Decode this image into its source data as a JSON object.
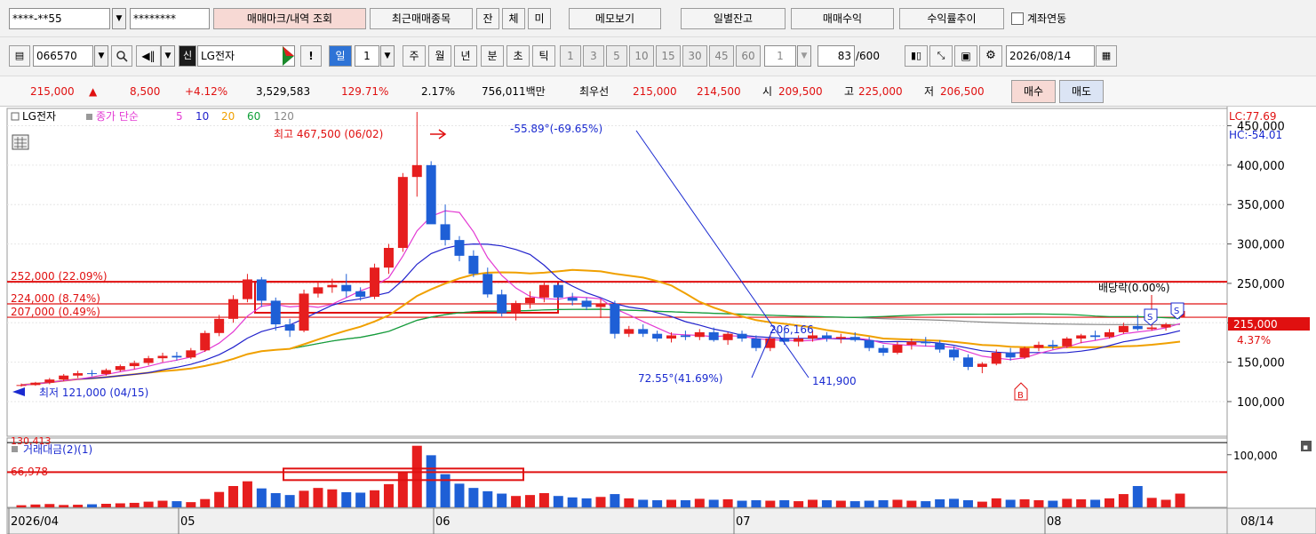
{
  "toolbar1": {
    "account": "****-**55",
    "password": "********",
    "btn_trade_mark": "매매마크/내역 조회",
    "btn_recent": "최근매매종목",
    "btn_jan": "잔",
    "btn_che": "체",
    "btn_mi": "미",
    "btn_memo": "메모보기",
    "btn_daily": "일별잔고",
    "btn_profit": "매매수익",
    "btn_rate": "수익률추이",
    "link_label": "계좌연동"
  },
  "toolbar2": {
    "code": "066570",
    "badge": "신",
    "name": "LG전자",
    "excl": "!",
    "period_active": "일",
    "period_num": "1",
    "periods": [
      "주",
      "월",
      "년",
      "분",
      "초",
      "틱"
    ],
    "intervals": [
      "1",
      "3",
      "5",
      "10",
      "15",
      "30",
      "45",
      "60"
    ],
    "interval_value": "1",
    "count": "83",
    "count_max": "/600",
    "date": "2026/08/14"
  },
  "quote": {
    "price": "215,000",
    "arrow": "▲",
    "change": "8,500",
    "change_pct": "+4.12%",
    "volume": "3,529,583",
    "vol_ratio": "129.71%",
    "turnover": "2.17%",
    "amount": "756,011백만",
    "best_label": "최우선",
    "ask": "215,000",
    "bid": "214,500",
    "open_label": "시",
    "open": "209,500",
    "high_label": "고",
    "high": "225,000",
    "low_label": "저",
    "low": "206,500",
    "buy": "매수",
    "sell": "매도"
  },
  "chart_data": {
    "type": "candlestick",
    "legend": {
      "name": "LG전자",
      "series_label": "종가 단순",
      "ma": [
        {
          "period": "5",
          "color": "#e33ad3"
        },
        {
          "period": "10",
          "color": "#2222cc"
        },
        {
          "period": "20",
          "color": "#f0a000"
        },
        {
          "period": "60",
          "color": "#0fa038"
        },
        {
          "period": "120",
          "color": "#888888"
        }
      ]
    },
    "lc": "LC:77.69",
    "hc": "HC:-54.01",
    "y_ticks": [
      "450,000",
      "400,000",
      "350,000",
      "300,000",
      "250,000",
      "200,000",
      "150,000",
      "100,000"
    ],
    "y_tick_values": [
      450000,
      400000,
      350000,
      300000,
      250000,
      200000,
      150000,
      100000
    ],
    "ylim": [
      56000,
      472000
    ],
    "current_price_label": "215,000",
    "current_pct_label": "4.37%",
    "h_levels": [
      {
        "value": 252000,
        "label": "252,000 (22.09%)"
      },
      {
        "value": 224000,
        "label": "224,000 (8.74%)"
      },
      {
        "value": 207000,
        "label": "207,000 (0.49%)"
      }
    ],
    "annotations": {
      "high": "최고 467,500 (06/02)",
      "low": "최저 121,000 (04/15)",
      "trend_up": "-55.89°(-69.65%)",
      "trend_down": "72.55°(41.69%)",
      "line_pt_a": "206,166",
      "line_pt_b": "141,900",
      "dividend": "배당락(0.00%)",
      "marker_s": "S",
      "marker_b": "B"
    },
    "volume_panel": {
      "title": "거래대금(2)(1)",
      "level_label": "66,978",
      "tick": "100,000",
      "tick_value": 100000,
      "level_value": 66978,
      "ymax": 130000
    },
    "x_labels": [
      "2026/04",
      "05",
      "06",
      "07",
      "08",
      "08/14"
    ],
    "candles": [
      [
        120000,
        123000,
        119000,
        121000
      ],
      [
        121000,
        125000,
        120000,
        124000
      ],
      [
        124000,
        130000,
        122000,
        128000
      ],
      [
        128000,
        135000,
        126000,
        133000
      ],
      [
        133000,
        139000,
        130000,
        136000
      ],
      [
        136000,
        140000,
        132000,
        135000
      ],
      [
        135000,
        142000,
        133000,
        140000
      ],
      [
        140000,
        147000,
        138000,
        145000
      ],
      [
        145000,
        152000,
        141000,
        149000
      ],
      [
        149000,
        158000,
        146000,
        155000
      ],
      [
        155000,
        162000,
        150000,
        158000
      ],
      [
        158000,
        163000,
        152000,
        156000
      ],
      [
        156000,
        168000,
        154000,
        165000
      ],
      [
        165000,
        190000,
        163000,
        187000
      ],
      [
        187000,
        210000,
        183000,
        205000
      ],
      [
        205000,
        235000,
        200000,
        230000
      ],
      [
        230000,
        262000,
        226000,
        255000
      ],
      [
        255000,
        258000,
        220000,
        228000
      ],
      [
        228000,
        232000,
        190000,
        198000
      ],
      [
        198000,
        205000,
        182000,
        190000
      ],
      [
        190000,
        242000,
        188000,
        237000
      ],
      [
        237000,
        252000,
        232000,
        245000
      ],
      [
        245000,
        256000,
        238000,
        248000
      ],
      [
        248000,
        262000,
        232000,
        240000
      ],
      [
        240000,
        245000,
        228000,
        233000
      ],
      [
        233000,
        275000,
        230000,
        270000
      ],
      [
        270000,
        300000,
        262000,
        295000
      ],
      [
        295000,
        390000,
        290000,
        385000
      ],
      [
        385000,
        467500,
        360000,
        400000
      ],
      [
        400000,
        405000,
        330000,
        325000
      ],
      [
        325000,
        350000,
        298000,
        305000
      ],
      [
        305000,
        310000,
        278000,
        285000
      ],
      [
        285000,
        292000,
        258000,
        262000
      ],
      [
        262000,
        270000,
        232000,
        236000
      ],
      [
        236000,
        242000,
        208000,
        212000
      ],
      [
        212000,
        228000,
        203000,
        225000
      ],
      [
        225000,
        240000,
        218000,
        232000
      ],
      [
        232000,
        252000,
        226000,
        248000
      ],
      [
        248000,
        250000,
        228000,
        232000
      ],
      [
        232000,
        238000,
        222000,
        228000
      ],
      [
        228000,
        232000,
        216000,
        220000
      ],
      [
        220000,
        230000,
        206000,
        224000
      ],
      [
        224000,
        228000,
        180000,
        186000
      ],
      [
        186000,
        196000,
        182000,
        192000
      ],
      [
        192000,
        198000,
        182000,
        186000
      ],
      [
        186000,
        190000,
        176000,
        180000
      ],
      [
        180000,
        188000,
        175000,
        184000
      ],
      [
        184000,
        190000,
        178000,
        182000
      ],
      [
        182000,
        192000,
        178000,
        188000
      ],
      [
        188000,
        194000,
        176000,
        178000
      ],
      [
        178000,
        188000,
        172000,
        186000
      ],
      [
        186000,
        190000,
        176000,
        180000
      ],
      [
        180000,
        184000,
        164000,
        168000
      ],
      [
        168000,
        184000,
        164000,
        180000
      ],
      [
        180000,
        188000,
        172000,
        176000
      ],
      [
        176000,
        184000,
        170000,
        180000
      ],
      [
        180000,
        190000,
        176000,
        184000
      ],
      [
        184000,
        188000,
        176000,
        180000
      ],
      [
        180000,
        186000,
        174000,
        182000
      ],
      [
        182000,
        188000,
        176000,
        178000
      ],
      [
        178000,
        182000,
        164000,
        168000
      ],
      [
        168000,
        172000,
        158000,
        162000
      ],
      [
        162000,
        176000,
        160000,
        172000
      ],
      [
        172000,
        180000,
        166000,
        176000
      ],
      [
        176000,
        182000,
        170000,
        174000
      ],
      [
        174000,
        178000,
        162000,
        166000
      ],
      [
        166000,
        170000,
        152000,
        156000
      ],
      [
        156000,
        160000,
        140000,
        144000
      ],
      [
        144000,
        150000,
        136000,
        148000
      ],
      [
        148000,
        166000,
        146000,
        162000
      ],
      [
        162000,
        168000,
        152000,
        156000
      ],
      [
        156000,
        170000,
        154000,
        168000
      ],
      [
        168000,
        176000,
        164000,
        172000
      ],
      [
        172000,
        178000,
        166000,
        170000
      ],
      [
        170000,
        182000,
        168000,
        180000
      ],
      [
        180000,
        186000,
        174000,
        184000
      ],
      [
        184000,
        190000,
        178000,
        182000
      ],
      [
        182000,
        192000,
        180000,
        188000
      ],
      [
        188000,
        200000,
        186000,
        196000
      ],
      [
        196000,
        210000,
        190000,
        192000
      ],
      [
        192000,
        198000,
        190000,
        194000
      ],
      [
        194000,
        200000,
        190000,
        198000
      ],
      [
        206500,
        225000,
        206500,
        215000
      ]
    ],
    "volumes": [
      900,
      1200,
      1400,
      1000,
      1100,
      1300,
      1500,
      1700,
      1900,
      2400,
      2800,
      2600,
      2200,
      3500,
      6500,
      9000,
      11000,
      8000,
      6000,
      5200,
      7000,
      8200,
      7600,
      6400,
      6200,
      7200,
      9800,
      15000,
      26000,
      22000,
      14000,
      10000,
      8200,
      6800,
      5800,
      4800,
      5200,
      6000,
      4800,
      4200,
      3800,
      4400,
      5600,
      3800,
      3200,
      3000,
      3200,
      3000,
      3600,
      3200,
      3400,
      2800,
      3000,
      2800,
      3000,
      2600,
      3200,
      3000,
      2800,
      2600,
      2800,
      3000,
      3200,
      2800,
      2600,
      3400,
      3600,
      3000,
      2400,
      3800,
      3200,
      3400,
      3000,
      2800,
      3600,
      3400,
      3200,
      3800,
      5600,
      9000,
      4000,
      3200,
      5800
    ]
  }
}
